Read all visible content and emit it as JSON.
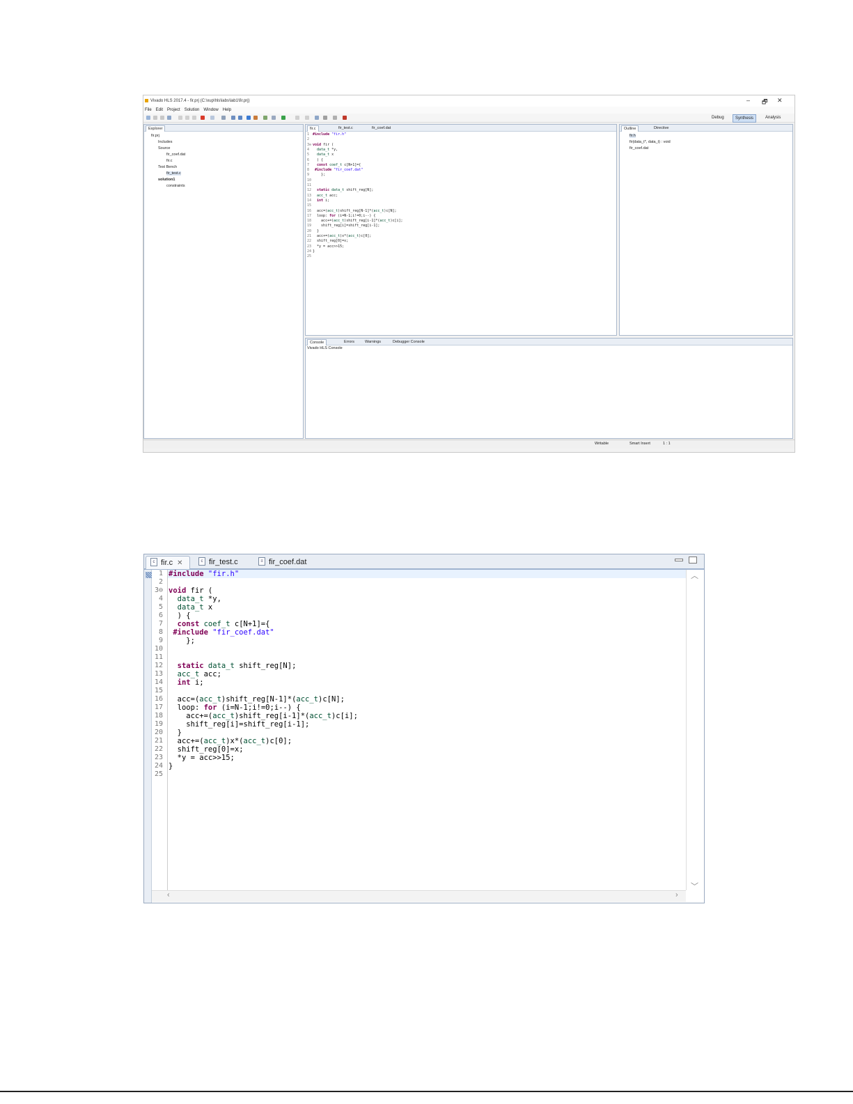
{
  "ide": {
    "title": "Vivado HLS 2017.4 - fir.prj (C:\\xup\\hls\\labs\\lab1\\fir.prj)",
    "window_controls": [
      "–",
      "🗗",
      "✕"
    ],
    "menu": [
      "File",
      "Edit",
      "Project",
      "Solution",
      "Window",
      "Help"
    ],
    "perspectives": [
      "Debug",
      "Synthesis",
      "Analysis"
    ],
    "explorer": {
      "tab": "Explorer",
      "items": [
        "fir.prj",
        "Includes",
        "Source",
        "fir_coef.dat",
        "fir.c",
        "Test Bench",
        "fir_test.c",
        "solution1",
        "constraints"
      ]
    },
    "editor_tabs": [
      "fir.c",
      "fir_test.c",
      "fir_coef.dat"
    ],
    "outline": {
      "tabs": [
        "Outline",
        "Directive"
      ],
      "items": [
        "fir.h",
        "fir(data_t*, data_t) : void",
        "fir_coef.dat"
      ]
    },
    "console": {
      "tabs": [
        "Console",
        "Errors",
        "Warnings",
        "Debugger Console"
      ],
      "title": "Vivado HLS Console"
    },
    "status": [
      "Writable",
      "Smart Insert",
      "1 : 1"
    ]
  },
  "editor": {
    "tabs": [
      {
        "label": "fir.c",
        "icon": "c"
      },
      {
        "label": "fir_test.c",
        "icon": "c"
      },
      {
        "label": "fir_coef.dat",
        "icon": "doc"
      }
    ],
    "line_numbers": [
      "1",
      "2",
      "3⊖",
      "4",
      "5",
      "6",
      "7",
      "8",
      "9",
      "10",
      "11",
      "12",
      "13",
      "14",
      "15",
      "16",
      "17",
      "18",
      "19",
      "20",
      "21",
      "22",
      "23",
      "24",
      "25"
    ],
    "code": [
      "#include \"fir.h\"",
      "",
      "void fir (",
      "  data_t *y,",
      "  data_t x",
      "  ) {",
      "  const coef_t c[N+1]={",
      " #include \"fir_coef.dat\"",
      "    };",
      "",
      "",
      "  static data_t shift_reg[N];",
      "  acc_t acc;",
      "  int i;",
      "",
      "  acc=(acc_t)shift_reg[N-1]*(acc_t)c[N];",
      "  loop: for (i=N-1;i!=0;i--) {",
      "    acc+=(acc_t)shift_reg[i-1]*(acc_t)c[i];",
      "    shift_reg[i]=shift_reg[i-1];",
      "  }",
      "  acc+=(acc_t)x*(acc_t)c[0];",
      "  shift_reg[0]=x;",
      "  *y = acc>>15;",
      "}",
      ""
    ]
  }
}
